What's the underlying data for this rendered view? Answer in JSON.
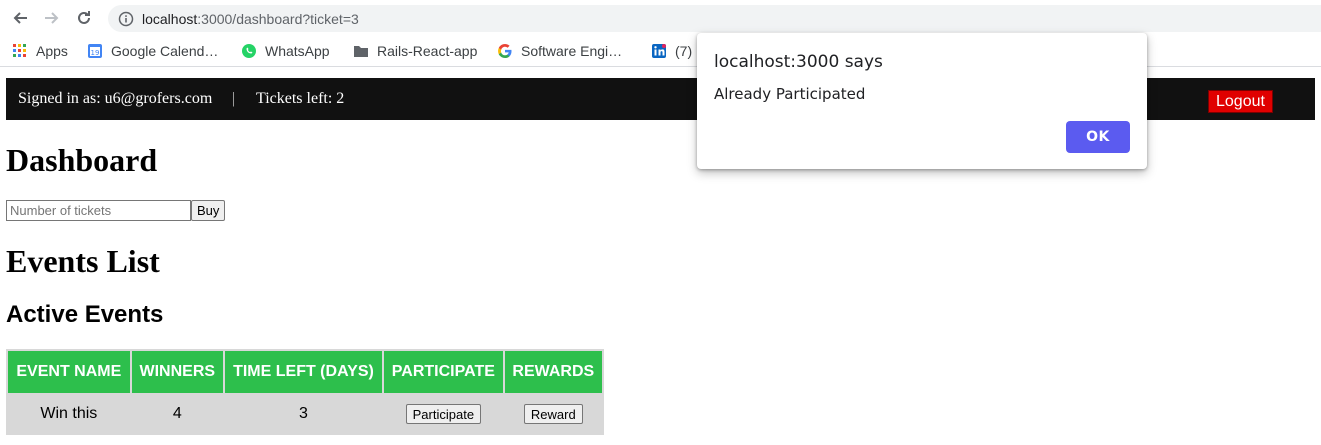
{
  "browser": {
    "url_host": "localhost",
    "url_path": ":3000/dashboard?ticket=3",
    "bookmarks": [
      {
        "label": "Apps",
        "icon": "apps-grid-icon"
      },
      {
        "label": "Google Calend…",
        "icon": "google-calendar-icon"
      },
      {
        "label": "WhatsApp",
        "icon": "whatsapp-icon"
      },
      {
        "label": "Rails-React-app",
        "icon": "folder-icon"
      },
      {
        "label": "Software Engi…",
        "icon": "google-icon"
      },
      {
        "label": "(7)",
        "icon": "linkedin-icon"
      }
    ]
  },
  "navbar": {
    "signed_in": "Signed in as: u6@grofers.com",
    "separator": "|",
    "tickets_left": "Tickets left: 2",
    "logout_label": "Logout"
  },
  "page": {
    "title": "Dashboard",
    "tickets_placeholder": "Number of tickets",
    "buy_label": "Buy",
    "events_heading": "Events List",
    "active_heading": "Active Events"
  },
  "events_table": {
    "headers": [
      "EVENT NAME",
      "WINNERS",
      "TIME LEFT (DAYS)",
      "PARTICIPATE",
      "REWARDS"
    ],
    "rows": [
      {
        "event_name": "Win this",
        "winners": "4",
        "time_left": "3",
        "participate_label": "Participate",
        "rewards_label": "Reward"
      }
    ]
  },
  "dialog": {
    "title": "localhost:3000 says",
    "message": "Already Participated",
    "ok_label": "OK"
  },
  "colors": {
    "navbar_bg": "#111111",
    "logout_bg": "#e00000",
    "table_header_bg": "#2dbf4c",
    "dialog_ok_bg": "#5b5bf0"
  }
}
